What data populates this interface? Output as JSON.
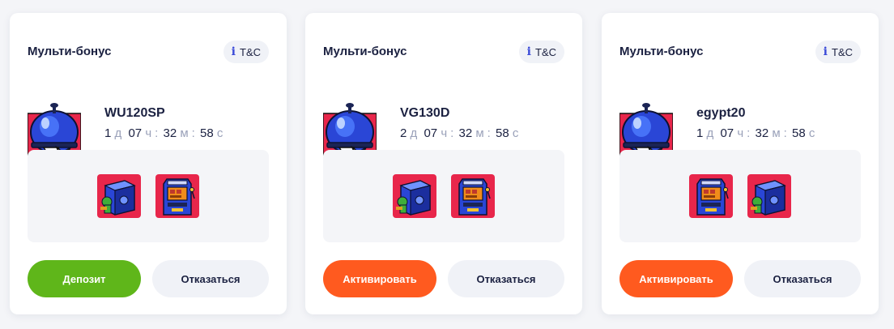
{
  "colors": {
    "deposit": "#5fb61a",
    "activate": "#ff5a1f",
    "accent_red": "#e8264b",
    "secondary_bg": "#f0f2f7"
  },
  "cards": [
    {
      "title": "Мульти-бонус",
      "tc_icon": "i",
      "tc_label": "T&C",
      "code": "WU120SP",
      "timer": {
        "days": "1",
        "d": "д",
        "hours": "07",
        "h": "ч",
        "minutes": "32",
        "m": "м",
        "seconds": "58",
        "s": "с",
        "colon": ":"
      },
      "primary_label": "Депозит",
      "primary_color": "#5fb61a",
      "secondary_label": "Отказаться",
      "games": [
        "safe-slot-icon",
        "arcade-slot-icon"
      ]
    },
    {
      "title": "Мульти-бонус",
      "tc_icon": "i",
      "tc_label": "T&C",
      "code": "VG130D",
      "timer": {
        "days": "2",
        "d": "д",
        "hours": "07",
        "h": "ч",
        "minutes": "32",
        "m": "м",
        "seconds": "58",
        "s": "с",
        "colon": ":"
      },
      "primary_label": "Активировать",
      "primary_color": "#ff5a1f",
      "secondary_label": "Отказаться",
      "games": [
        "safe-slot-icon",
        "arcade-slot-icon"
      ]
    },
    {
      "title": "Мульти-бонус",
      "tc_icon": "i",
      "tc_label": "T&C",
      "code": "egypt20",
      "timer": {
        "days": "1",
        "d": "д",
        "hours": "07",
        "h": "ч",
        "minutes": "32",
        "m": "м",
        "seconds": "58",
        "s": "с",
        "colon": ":"
      },
      "primary_label": "Активировать",
      "primary_color": "#ff5a1f",
      "secondary_label": "Отказаться",
      "games": [
        "arcade-slot-icon",
        "safe-slot-icon"
      ]
    }
  ]
}
